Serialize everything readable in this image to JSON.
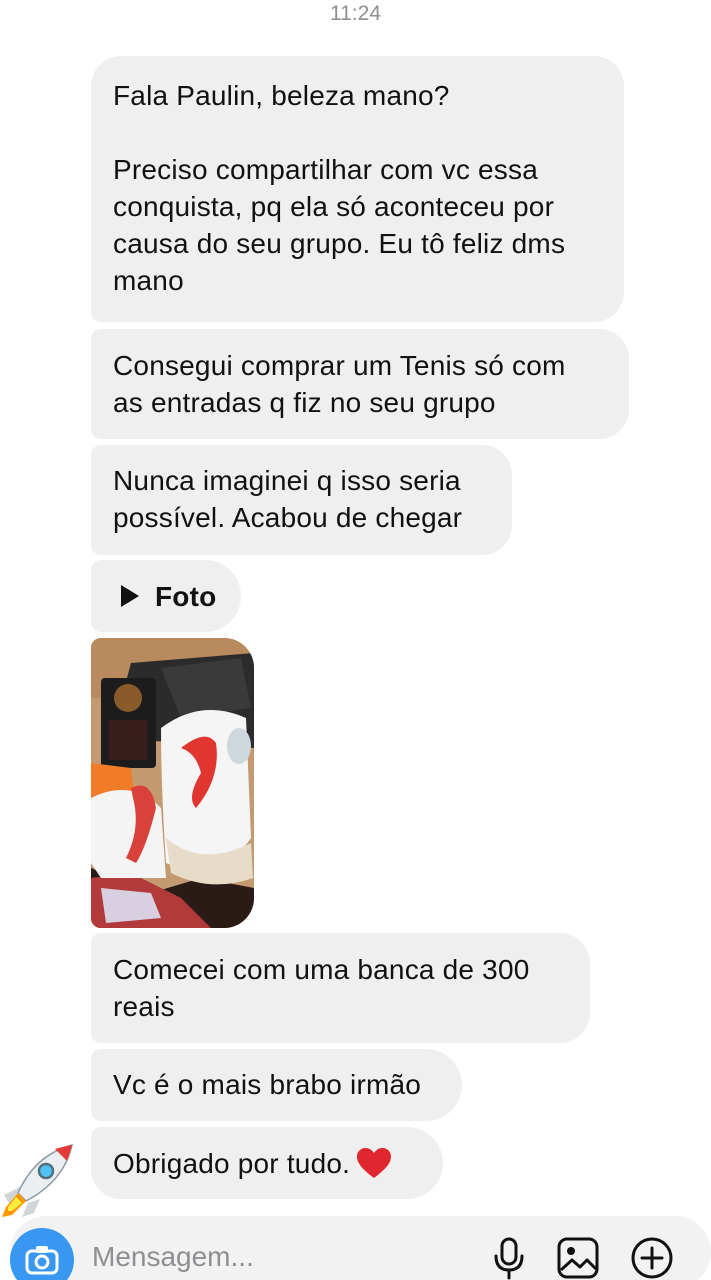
{
  "status": {
    "time": "11:24"
  },
  "messages": [
    {
      "lines": [
        "Fala Paulin, beleza mano?"
      ]
    },
    {
      "lines": [
        "Preciso compartilhar com vc essa",
        "conquista, pq ela só aconteceu por",
        "causa do seu grupo. Eu tô feliz dms",
        "mano"
      ]
    },
    {
      "lines": [
        "Consegui comprar um Tenis só com",
        "as entradas q fiz no seu grupo"
      ]
    },
    {
      "lines": [
        "Nunca imaginei q isso seria",
        "possível. Acabou de chegar"
      ]
    },
    {
      "label": "Foto"
    },
    {
      "lines": [
        "Comecei com uma banca de 300",
        "reais"
      ]
    },
    {
      "lines": [
        "Vc é o mais brabo irmão"
      ]
    },
    {
      "lines": [
        "Obrigado por tudo."
      ]
    }
  ],
  "composer": {
    "placeholder": "Mensagem...",
    "icons": [
      "camera-icon",
      "microphone-icon",
      "gallery-icon",
      "plus-circle-icon"
    ]
  },
  "colors": {
    "bubble": "#efefef",
    "accent": "#3897f0",
    "heart": "#e0262f"
  }
}
